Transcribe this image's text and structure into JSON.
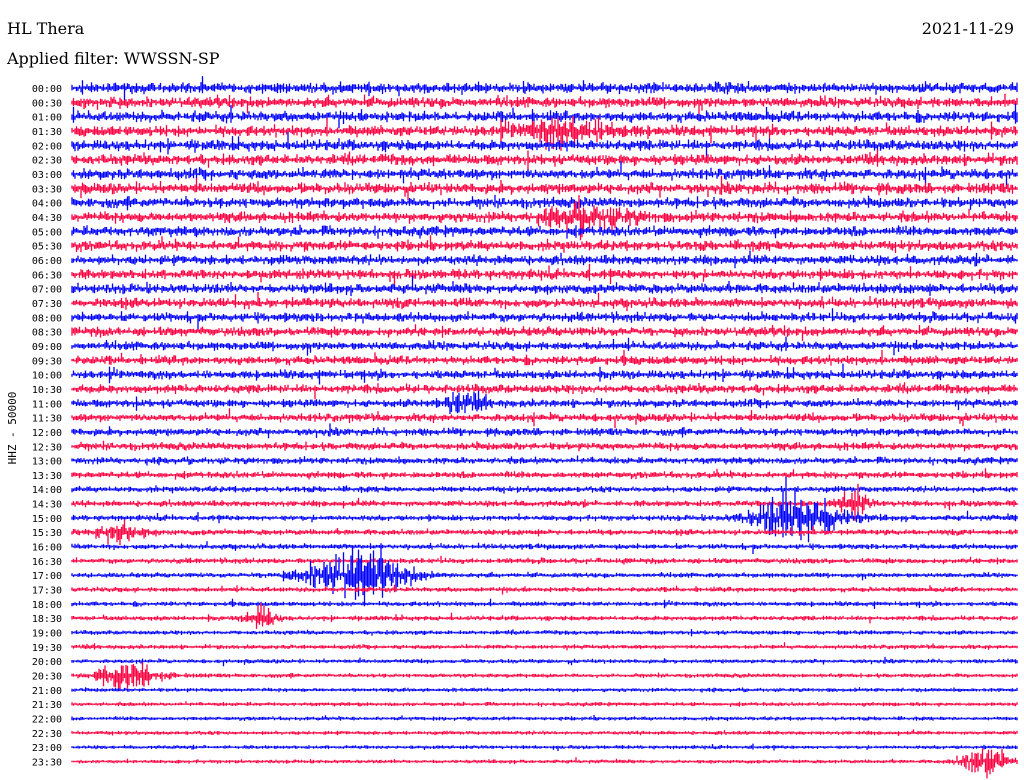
{
  "header": {
    "station": "HL Thera",
    "date": "2021-11-29",
    "filter": "Applied filter: WWSSN-SP"
  },
  "chart_data": {
    "type": "helicorder",
    "title": "HL Thera",
    "date": "2021-11-29",
    "filter": "Applied filter: WWSSN-SP",
    "ylabel": "HHZ - 50000",
    "row_labels": [
      "00:00",
      "00:30",
      "01:00",
      "01:30",
      "02:00",
      "02:30",
      "03:00",
      "03:30",
      "04:00",
      "04:30",
      "05:00",
      "05:30",
      "06:00",
      "06:30",
      "07:00",
      "07:30",
      "08:00",
      "08:30",
      "09:00",
      "09:30",
      "10:00",
      "10:30",
      "11:00",
      "11:30",
      "12:00",
      "12:30",
      "13:00",
      "13:30",
      "14:00",
      "14:30",
      "15:00",
      "15:30",
      "16:00",
      "16:30",
      "17:00",
      "17:30",
      "18:00",
      "18:30",
      "19:00",
      "19:30",
      "20:00",
      "20:30",
      "21:00",
      "21:30",
      "22:00",
      "22:30",
      "23:00",
      "23:30"
    ],
    "row_minutes": 30,
    "colors": [
      "#0000ff",
      "#ff0040"
    ],
    "noise_by_hour": [
      4.5,
      4.5,
      4.5,
      4.5,
      4.3,
      4.2,
      4.0,
      4.0,
      3.8,
      3.6,
      3.6,
      3.2,
      3.0,
      2.6,
      2.3,
      2.1,
      2.0,
      1.8,
      1.7,
      1.5,
      1.4,
      1.3,
      1.3,
      1.2
    ],
    "events": [
      {
        "row": 3,
        "min": 15.8,
        "amp": 12,
        "dur": 1.8
      },
      {
        "row": 9,
        "min": 16.4,
        "amp": 12,
        "dur": 1.5
      },
      {
        "row": 22,
        "min": 12.3,
        "amp": 10,
        "dur": 0.8
      },
      {
        "row": 29,
        "min": 24.8,
        "amp": 14,
        "dur": 0.5
      },
      {
        "row": 29,
        "min": 57.0,
        "amp": 10,
        "dur": 0.5
      },
      {
        "row": 30,
        "min": 23.1,
        "amp": 28,
        "dur": 1.5
      },
      {
        "row": 30,
        "min": 30.9,
        "amp": 8,
        "dur": 0.8
      },
      {
        "row": 31,
        "min": 1.5,
        "amp": 12,
        "dur": 0.8
      },
      {
        "row": 34,
        "min": 9.0,
        "amp": 24,
        "dur": 1.8
      },
      {
        "row": 37,
        "min": 6.0,
        "amp": 12,
        "dur": 0.5
      },
      {
        "row": 41,
        "min": 1.8,
        "amp": 12,
        "dur": 1.2
      },
      {
        "row": 46,
        "min": 41.0,
        "amp": 18,
        "dur": 0.7
      },
      {
        "row": 46,
        "min": 49.0,
        "amp": 7,
        "dur": 0.8
      },
      {
        "row": 47,
        "min": 29.0,
        "amp": 16,
        "dur": 0.8
      }
    ]
  }
}
